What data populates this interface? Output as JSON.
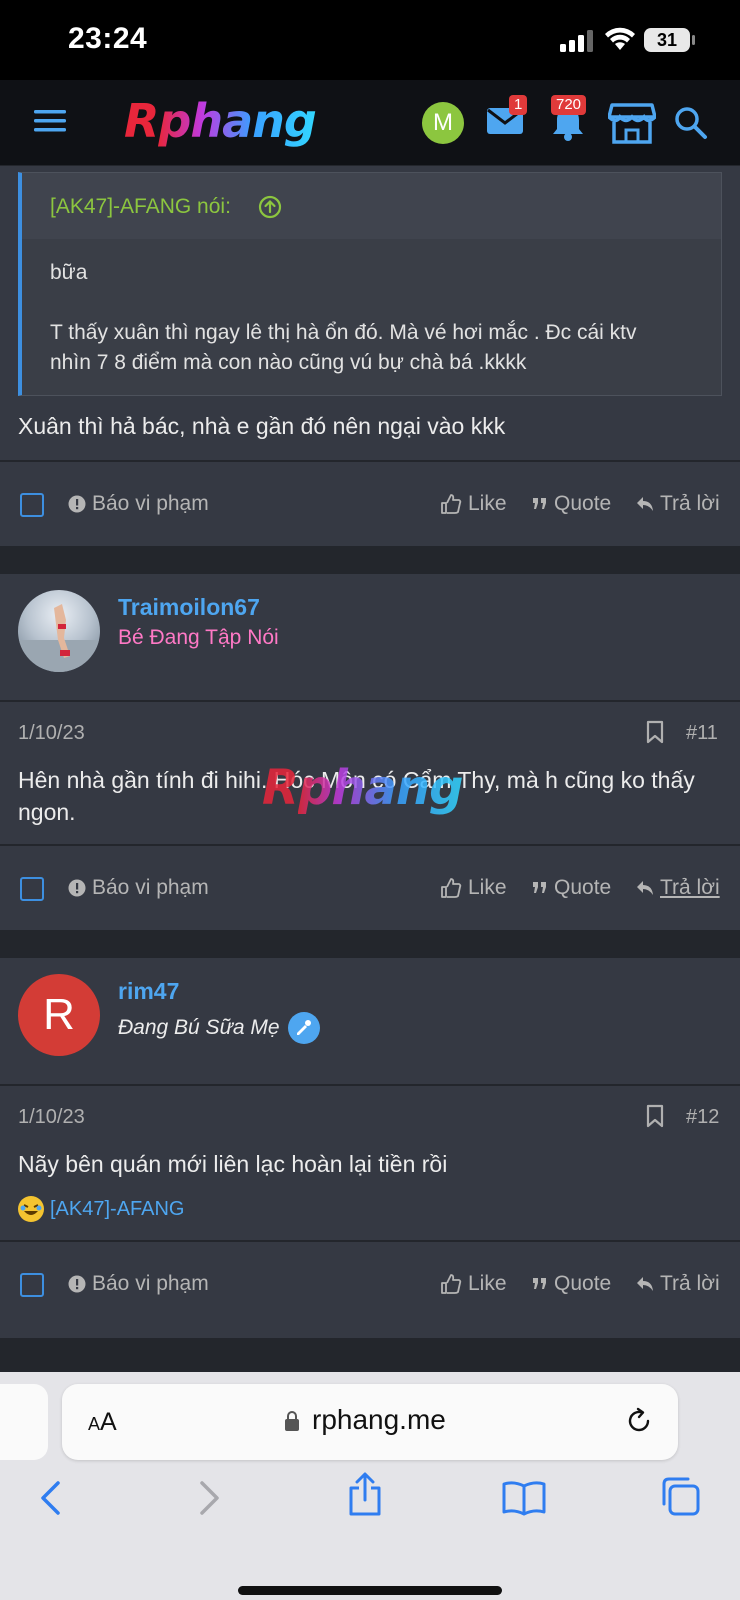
{
  "status_bar": {
    "time": "23:24",
    "battery": "31"
  },
  "header": {
    "logo_r": "R",
    "logo_rest": "phang",
    "avatar_initial": "M",
    "mail_badge": "1",
    "alerts_badge": "720"
  },
  "posts": [
    {
      "quote": {
        "author": "[AK47]-AFANG nói:",
        "line1": "bữa",
        "line2": "T thấy xuân thì ngay lê thị hà ổn đó. Mà vé hơi mắc . Đc cái ktv",
        "line3": "nhìn 7 8 điểm mà con nào cũng vú bự chà bá .kkkk"
      },
      "text": "Xuân thì hả bác, nhà e gần đó nên ngại vào kkk"
    },
    {
      "username": "Traimoilon67",
      "user_title": "Bé Đang Tập Nói",
      "date": "1/10/23",
      "number": "#11",
      "text_line1": "Hên nhà gần tính đi hihi. Hóc Môn có Cẩm Thy, mà h cũng ko thấy",
      "text_line2": "ngon."
    },
    {
      "avatar_initial": "R",
      "username": "rim47",
      "user_title": "Đang Bú Sữa Mẹ",
      "date": "1/10/23",
      "number": "#12",
      "text": "Nãy bên quán mới liên lạc hoàn lại tiền rồi",
      "reaction_user": "[AK47]-AFANG"
    }
  ],
  "actions": {
    "report": "Báo vi phạm",
    "like": "Like",
    "quote": "Quote",
    "reply": "Trả lời"
  },
  "watermark": {
    "r": "R",
    "rest": "phang"
  },
  "browser": {
    "aa_small": "A",
    "aa_large": "A",
    "url": "rphang.me"
  },
  "colors": {
    "accent_blue": "#3d8fe0",
    "username_blue": "#4ea6f0",
    "quote_author_green": "#8cc63f",
    "title_pink": "#ff79c6",
    "badge_red": "#e03a3a"
  }
}
